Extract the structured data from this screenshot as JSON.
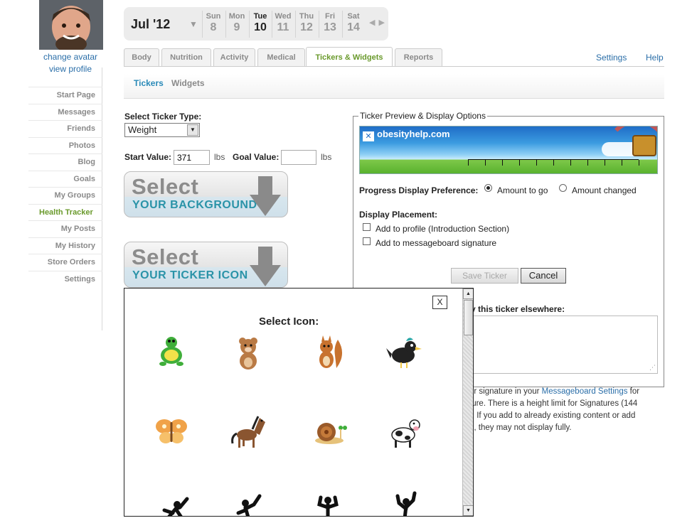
{
  "sidebar": {
    "change_avatar": "change avatar",
    "view_profile": "view profile",
    "items": [
      {
        "label": "Start Page"
      },
      {
        "label": "Messages"
      },
      {
        "label": "Friends"
      },
      {
        "label": "Photos"
      },
      {
        "label": "Blog"
      },
      {
        "label": "Goals"
      },
      {
        "label": "My Groups"
      },
      {
        "label": "Health Tracker",
        "active": true
      },
      {
        "label": "My Posts"
      },
      {
        "label": "My History"
      },
      {
        "label": "Store Orders"
      },
      {
        "label": "Settings"
      }
    ]
  },
  "datebar": {
    "month": "Jul '12",
    "days": [
      {
        "name": "Sun",
        "date": "8"
      },
      {
        "name": "Mon",
        "date": "9"
      },
      {
        "name": "Tue",
        "date": "10",
        "current": true
      },
      {
        "name": "Wed",
        "date": "11"
      },
      {
        "name": "Thu",
        "date": "12"
      },
      {
        "name": "Fri",
        "date": "13"
      },
      {
        "name": "Sat",
        "date": "14"
      }
    ]
  },
  "tabs": [
    {
      "label": "Body"
    },
    {
      "label": "Nutrition"
    },
    {
      "label": "Activity"
    },
    {
      "label": "Medical"
    },
    {
      "label": "Tickers & Widgets",
      "active": true
    },
    {
      "label": "Reports"
    }
  ],
  "top_links": {
    "settings": "Settings",
    "help": "Help"
  },
  "subtabs": {
    "tickers": "Tickers",
    "widgets": "Widgets"
  },
  "form": {
    "ticker_type_label": "Select Ticker Type:",
    "ticker_type_value": "Weight",
    "start_label": "Start Value:",
    "start_value": "371",
    "goal_label": "Goal Value:",
    "goal_value": "",
    "unit": "lbs",
    "select_bg": {
      "line1": "Select",
      "line2": "YOUR BACKGROUND"
    },
    "select_icon": {
      "line1": "Select",
      "line2": "YOUR TICKER ICON"
    }
  },
  "preview": {
    "legend": "Ticker Preview & Display Options",
    "banner_logo": "obesityhelp.com",
    "progress_label": "Progress Display Preference:",
    "amount_to_go": "Amount to go",
    "amount_changed": "Amount changed",
    "progress_selected": "Amount to go",
    "placement_label": "Display Placement:",
    "add_profile": "Add to profile (Introduction Section)",
    "add_signature": "Add to messageboard signature",
    "save_button": "Save Ticker",
    "cancel_button": "Cancel",
    "elsewhere_label": "y this ticker elsewhere:",
    "note_pre": "ur signature in your ",
    "note_link": "Messageboard Settings",
    "note_post": " for",
    "note_line2": "ture. There is a height limit for Signatures (144",
    "note_line3": "). If you add to already existing content or add",
    "note_line4": "n, they may not display fully."
  },
  "modal": {
    "close": "X",
    "title": "Select Icon:",
    "icons": [
      {
        "name": "turtle-icon",
        "color": "#3fae3a"
      },
      {
        "name": "bear-icon",
        "color": "#b97a45"
      },
      {
        "name": "squirrel-icon",
        "color": "#c8722e"
      },
      {
        "name": "bird-icon",
        "color": "#222222"
      },
      {
        "name": "butterfly-icon",
        "color": "#f0a248"
      },
      {
        "name": "horse-icon",
        "color": "#8a5530"
      },
      {
        "name": "snail-icon",
        "color": "#9a5a2a"
      },
      {
        "name": "cow-icon",
        "color": "#222222"
      },
      {
        "name": "dancer-silhouette-icon",
        "color": "#111111"
      },
      {
        "name": "runner-silhouette-icon",
        "color": "#111111"
      },
      {
        "name": "flexing-silhouette-icon",
        "color": "#111111"
      },
      {
        "name": "stretching-silhouette-icon",
        "color": "#111111"
      }
    ]
  }
}
